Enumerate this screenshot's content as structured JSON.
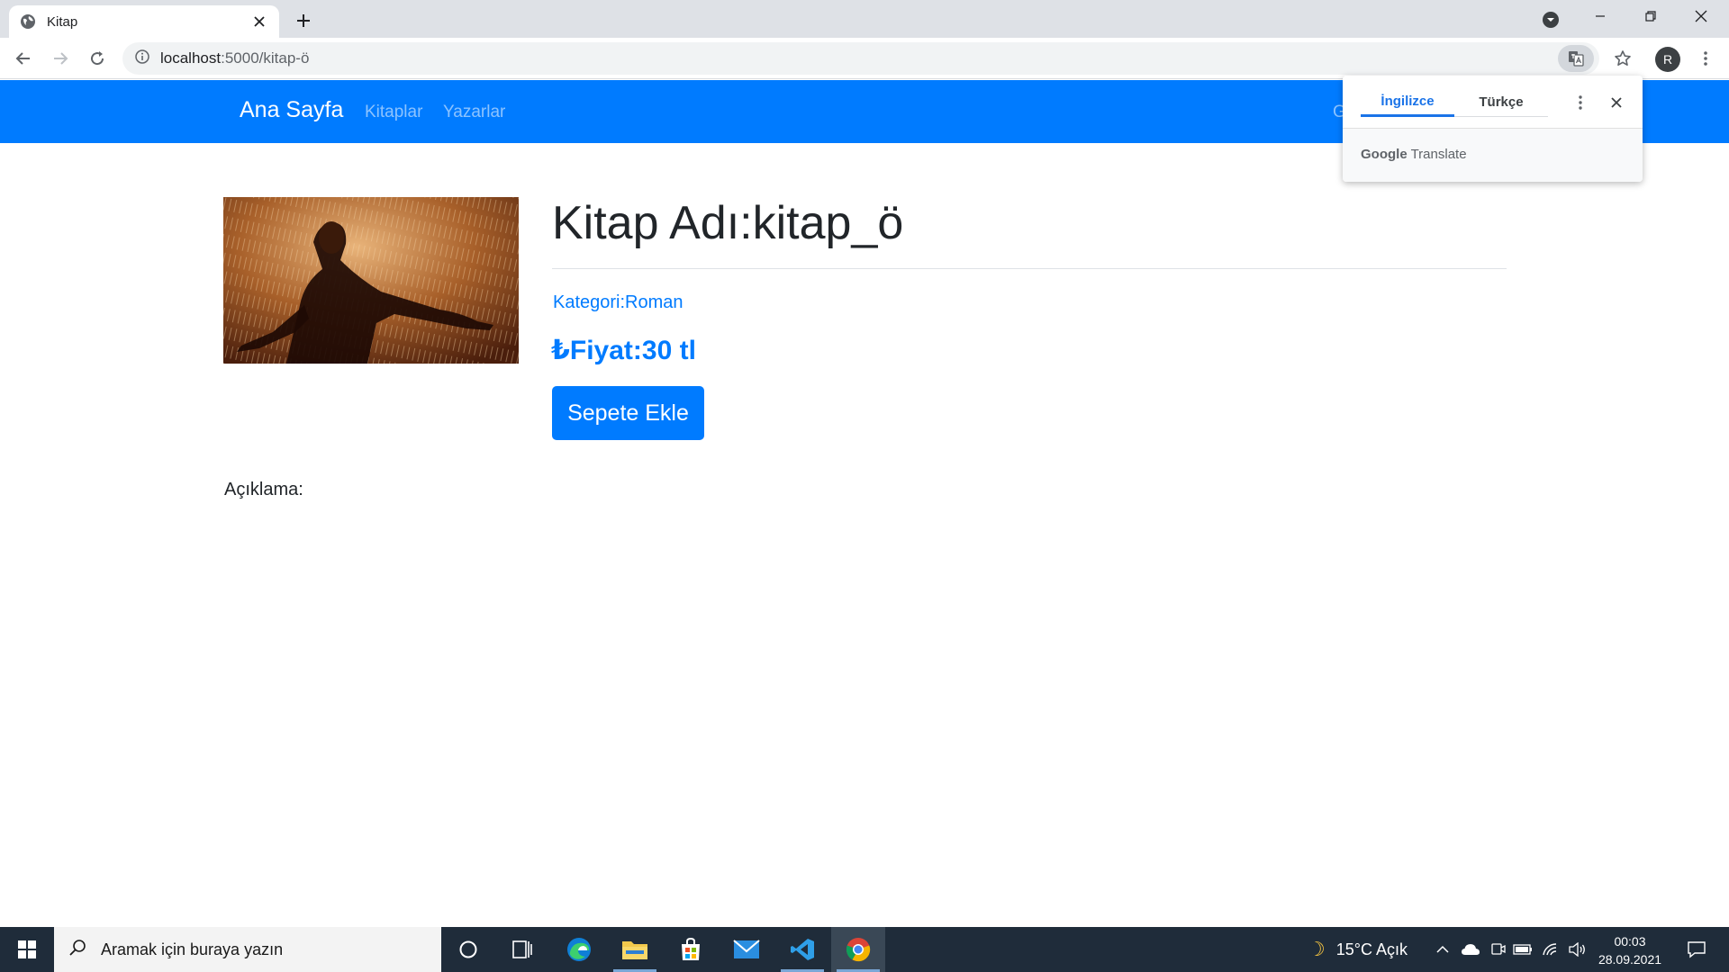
{
  "browser": {
    "tab_title": "Kitap",
    "url_host": "localhost",
    "url_path": ":5000/kitap-ö"
  },
  "translate_popup": {
    "tab_active": "İngilizce",
    "tab_other": "Türkçe",
    "brand_google": "Google",
    "brand_translate": "Translate"
  },
  "site_nav": {
    "brand": "Ana Sayfa",
    "links": [
      "Kitaplar",
      "Yazarlar"
    ],
    "right_partial": "G"
  },
  "book": {
    "title": "Kitap Adı:kitap_ö",
    "category": "Kategori:Roman",
    "price": "₺Fiyat:30 tl",
    "add_to_cart": "Sepete Ekle",
    "description_label": "Açıklama:"
  },
  "profile": {
    "initial": "R"
  },
  "taskbar": {
    "search_placeholder": "Aramak için buraya yazın",
    "weather": "15°C  Açık",
    "time": "00:03",
    "date": "28.09.2021"
  },
  "colors": {
    "primary": "#007bff",
    "taskbar": "#1f2c3a",
    "tabstrip": "#dee1e6"
  }
}
